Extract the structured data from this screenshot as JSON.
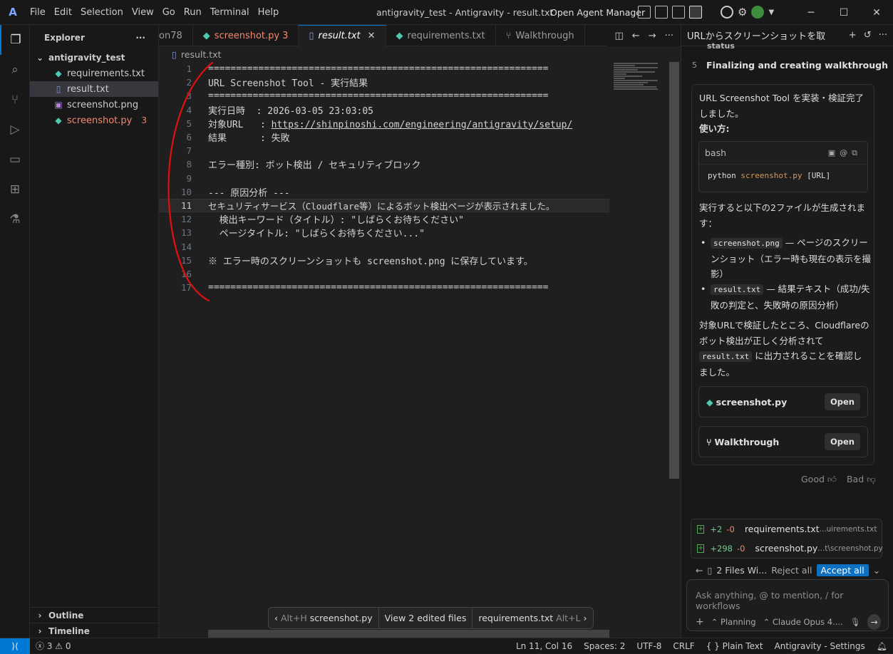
{
  "titlebar": {
    "logo": "A",
    "menu": [
      "File",
      "Edit",
      "Selection",
      "View",
      "Go",
      "Run",
      "Terminal",
      "Help"
    ],
    "window_title": "antigravity_test - Antigravity - result.txt",
    "agent_manager": "Open Agent Manager"
  },
  "explorer": {
    "title": "Explorer",
    "more": "···",
    "folder": "antigravity_test",
    "files": [
      {
        "name": "requirements.txt",
        "icon": "python-icon"
      },
      {
        "name": "result.txt",
        "icon": "file-icon"
      },
      {
        "name": "screenshot.png",
        "icon": "image-icon"
      },
      {
        "name": "screenshot.py",
        "icon": "python-icon",
        "badge": "3"
      }
    ],
    "outline": "Outline",
    "timeline": "Timeline"
  },
  "tabs": [
    {
      "label": "on78"
    },
    {
      "label": "screenshot.py",
      "badge": "3"
    },
    {
      "label": "result.txt"
    },
    {
      "label": "requirements.txt"
    },
    {
      "label": "Walkthrough"
    }
  ],
  "breadcrumb": "result.txt",
  "code_lines": [
    {
      "n": "1",
      "t": "============================================================="
    },
    {
      "n": "2",
      "t": "URL Screenshot Tool - 実行結果"
    },
    {
      "n": "3",
      "t": "============================================================="
    },
    {
      "n": "4",
      "t": "実行日時  : 2026-03-05 23:03:05"
    },
    {
      "n": "5",
      "t": "対象URL   : ",
      "link": "https://shinpinoshi.com/engineering/antigravity/setup/"
    },
    {
      "n": "6",
      "t": "結果      : 失敗"
    },
    {
      "n": "7",
      "t": ""
    },
    {
      "n": "8",
      "t": "エラー種別: ボット検出 / セキュリティブロック"
    },
    {
      "n": "9",
      "t": ""
    },
    {
      "n": "10",
      "t": "--- 原因分析 ---"
    },
    {
      "n": "11",
      "t": "セキュリティサービス（Cloudflare等）によるボット検出ページが表示されました。"
    },
    {
      "n": "12",
      "t": "  検出キーワード（タイトル）: \"しばらくお待ちください\""
    },
    {
      "n": "13",
      "t": "  ページタイトル: \"しばらくお待ちください...\""
    },
    {
      "n": "14",
      "t": ""
    },
    {
      "n": "15",
      "t": "※ エラー時のスクリーンショットも screenshot.png に保存しています。"
    },
    {
      "n": "16",
      "t": ""
    },
    {
      "n": "17",
      "t": "============================================================="
    }
  ],
  "floatbar": {
    "prev_key": "Alt+H",
    "prev_file": "screenshot.py",
    "middle": "View 2 edited files",
    "next_file": "requirements.txt",
    "next_key": "Alt+L"
  },
  "agent_panel": {
    "title": "URLからスクリーンショットを取",
    "step_partial": "status",
    "step_num": "5",
    "step_label": "Finalizing and creating walkthrough",
    "msg1": "URL Screenshot Tool を実装・検証完了しました。",
    "usage_label": "使い方:",
    "code_lang": "bash",
    "code_cmd": "python",
    "code_file": "screenshot.py",
    "code_arg": "[URL]",
    "msg2": "実行すると以下の2ファイルが生成されます：",
    "bullet1_code": "screenshot.png",
    "bullet1_text": " — ページのスクリーンショット（エラー時も現在の表示を撮影）",
    "bullet2_code": "result.txt",
    "bullet2_text": " — 結果テキスト（成功/失敗の判定と、失敗時の原因分析）",
    "msg3a": "対象URLで検証したところ、Cloudflareのボット検出が正しく分析されて",
    "msg3_code": "result.txt",
    "msg3b": " に出力されることを確認しました。",
    "card1": "screenshot.py",
    "card2": "Walkthrough",
    "open": "Open",
    "good": "Good",
    "bad": "Bad",
    "changes": [
      {
        "add": "+2",
        "del": "-0",
        "name": "requirements.txt",
        "path": "...uirements.txt"
      },
      {
        "add": "+298",
        "del": "-0",
        "name": "screenshot.py",
        "path": "...t\\screenshot.py"
      }
    ],
    "files_label": "2 Files Wi...",
    "reject_all": "Reject all",
    "accept_all": "Accept all",
    "input_placeholder": "Ask anything, @ to mention, / for workflows",
    "mode": "Planning",
    "model": "Claude Opus 4...."
  },
  "statusbar": {
    "errors": "3",
    "warnings": "0",
    "position": "Ln 11, Col 16",
    "spaces": "Spaces: 2",
    "encoding": "UTF-8",
    "eol": "CRLF",
    "language": "Plain Text",
    "settings": "Antigravity - Settings"
  }
}
